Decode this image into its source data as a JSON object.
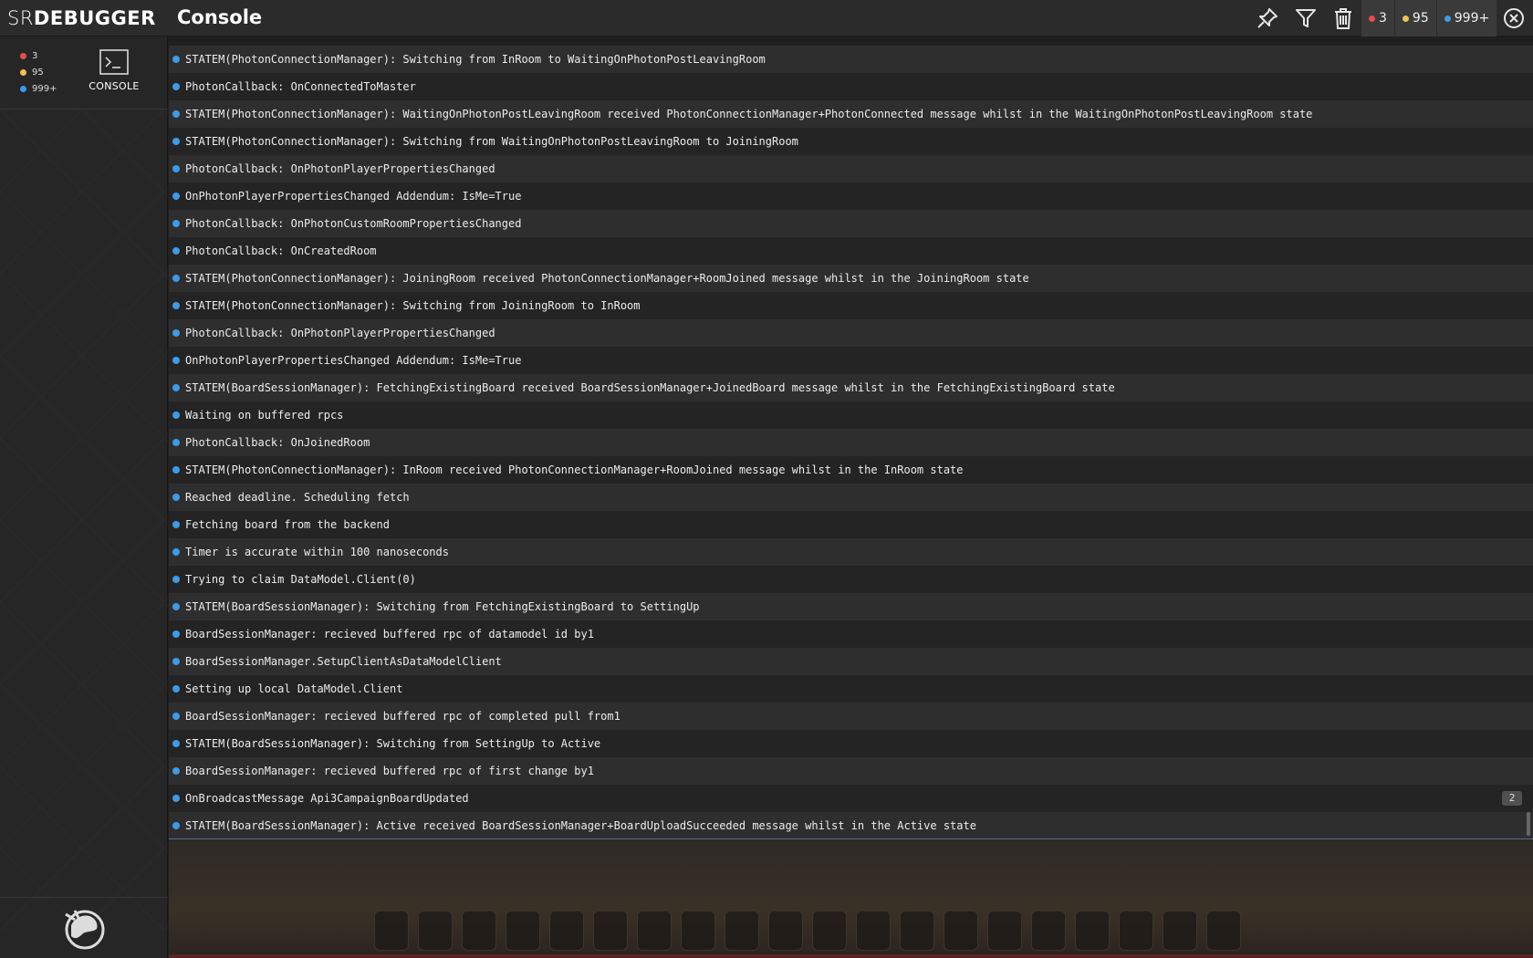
{
  "header": {
    "logo_prefix": "SR",
    "logo_suffix": "DEBUGGER",
    "title": "Console",
    "counters": [
      {
        "label": "3",
        "color": "#e84d4d"
      },
      {
        "label": "95",
        "color": "#f2c14e"
      },
      {
        "label": "999+",
        "color": "#3d9be8"
      }
    ]
  },
  "sidebar": {
    "counts": [
      {
        "label": "3",
        "color": "#e84d4d"
      },
      {
        "label": "95",
        "color": "#f2c14e"
      },
      {
        "label": "999+",
        "color": "#3d9be8"
      }
    ],
    "tab_label": "CONSOLE"
  },
  "log": {
    "entries": [
      {
        "text": "STATEM(PhotonConnectionManager): Switching from InRoom to WaitingOnPhotonPostLeavingRoom",
        "level": "info"
      },
      {
        "text": "PhotonCallback: OnConnectedToMaster",
        "level": "info"
      },
      {
        "text": "STATEM(PhotonConnectionManager): WaitingOnPhotonPostLeavingRoom received PhotonConnectionManager+PhotonConnected message whilst in the WaitingOnPhotonPostLeavingRoom state",
        "level": "info"
      },
      {
        "text": "STATEM(PhotonConnectionManager): Switching from WaitingOnPhotonPostLeavingRoom to JoiningRoom",
        "level": "info"
      },
      {
        "text": "PhotonCallback: OnPhotonPlayerPropertiesChanged",
        "level": "info"
      },
      {
        "text": "OnPhotonPlayerPropertiesChanged Addendum: IsMe=True",
        "level": "info"
      },
      {
        "text": "PhotonCallback: OnPhotonCustomRoomPropertiesChanged",
        "level": "info"
      },
      {
        "text": "PhotonCallback: OnCreatedRoom",
        "level": "info"
      },
      {
        "text": "STATEM(PhotonConnectionManager): JoiningRoom received PhotonConnectionManager+RoomJoined message whilst in the JoiningRoom state",
        "level": "info"
      },
      {
        "text": "STATEM(PhotonConnectionManager): Switching from JoiningRoom to InRoom",
        "level": "info"
      },
      {
        "text": "PhotonCallback: OnPhotonPlayerPropertiesChanged",
        "level": "info"
      },
      {
        "text": "OnPhotonPlayerPropertiesChanged Addendum: IsMe=True",
        "level": "info"
      },
      {
        "text": "STATEM(BoardSessionManager): FetchingExistingBoard received BoardSessionManager+JoinedBoard message whilst in the FetchingExistingBoard state",
        "level": "info"
      },
      {
        "text": "Waiting on buffered rpcs",
        "level": "info"
      },
      {
        "text": "PhotonCallback: OnJoinedRoom",
        "level": "info"
      },
      {
        "text": "STATEM(PhotonConnectionManager): InRoom received PhotonConnectionManager+RoomJoined message whilst in the InRoom state",
        "level": "info"
      },
      {
        "text": "Reached deadline. Scheduling fetch",
        "level": "info"
      },
      {
        "text": "Fetching board from the backend",
        "level": "info"
      },
      {
        "text": "Timer is accurate within 100 nanoseconds",
        "level": "info"
      },
      {
        "text": "Trying to claim DataModel.Client(0)",
        "level": "info"
      },
      {
        "text": "STATEM(BoardSessionManager): Switching from FetchingExistingBoard to SettingUp",
        "level": "info"
      },
      {
        "text": "BoardSessionManager: recieved buffered rpc of datamodel id by1",
        "level": "info"
      },
      {
        "text": "BoardSessionManager.SetupClientAsDataModelClient",
        "level": "info"
      },
      {
        "text": "Setting up local DataModel.Client",
        "level": "info"
      },
      {
        "text": "BoardSessionManager: recieved buffered rpc of completed pull from1",
        "level": "info"
      },
      {
        "text": "STATEM(BoardSessionManager): Switching from SettingUp to Active",
        "level": "info"
      },
      {
        "text": "BoardSessionManager: recieved buffered rpc of first change by1",
        "level": "info"
      },
      {
        "text": "OnBroadcastMessage Api3CampaignBoardUpdated",
        "level": "info",
        "count": "2"
      },
      {
        "text": "STATEM(BoardSessionManager): Active received BoardSessionManager+BoardUploadSucceeded message whilst in the Active state",
        "level": "info"
      }
    ]
  },
  "icons": {
    "pin": "pin-icon",
    "filter": "filter-icon",
    "clear": "trash-icon",
    "close": "close-icon",
    "console": "terminal-icon"
  }
}
